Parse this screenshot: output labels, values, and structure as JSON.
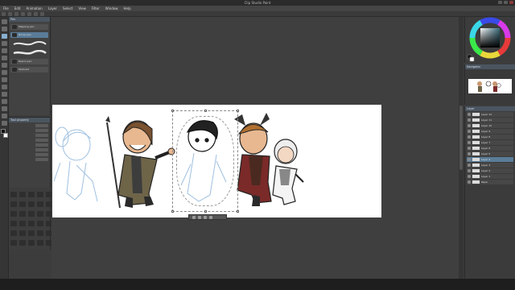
{
  "window": {
    "title": "Clip Studio Paint",
    "controls": [
      "minimize-icon",
      "maximize-icon",
      "close-icon"
    ]
  },
  "menu": [
    "File",
    "Edit",
    "Animation",
    "Layer",
    "Select",
    "View",
    "Filter",
    "Window",
    "Help"
  ],
  "subtool_panel": {
    "title": "Pen",
    "items": [
      "Mapping pen",
      "Turnip pen",
      "Real G-pen",
      "Textured"
    ]
  },
  "tool_property": {
    "title": "Tool property"
  },
  "navigator": {
    "title": "Navigator"
  },
  "layers": {
    "title": "Layer",
    "rows": [
      "Layer 12",
      "Layer 11",
      "Layer 10",
      "Layer 9",
      "Layer 8",
      "Layer 7",
      "Layer 6",
      "Layer 5",
      "Layer 4",
      "Layer 3",
      "Layer 2",
      "Layer 1",
      "Paper"
    ]
  },
  "colors": {
    "foreground": "#111111",
    "background": "#ffffff",
    "accent": "#5a7c98"
  }
}
